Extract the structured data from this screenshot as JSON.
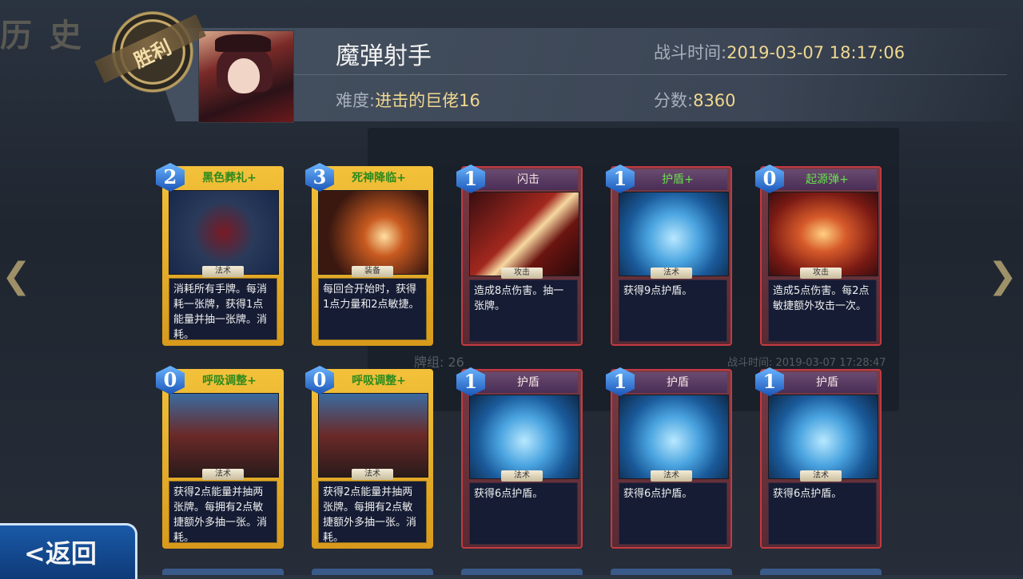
{
  "header": {
    "seal_text": "胜利",
    "character_name": "魔弹射手",
    "difficulty_label": "难度:",
    "difficulty_value": "进击的巨佬16",
    "time_label": "战斗时间:",
    "time_value": "2019-03-07 18:17:06",
    "score_label": "分数:",
    "score_value": "8360"
  },
  "background_text": {
    "history": "历 史",
    "deck_label": "牌组:",
    "deck_value": "26",
    "battle_time": "战斗时间: 2019-03-07 17:28:47"
  },
  "cards": [
    {
      "cost": "2",
      "title": "黑色葬礼+",
      "type": "法术",
      "desc": "消耗所有手牌。每消耗一张牌，获得1点能量并抽一张牌。消耗。",
      "style": "gold",
      "art": "black"
    },
    {
      "cost": "3",
      "title": "死神降临+",
      "type": "装备",
      "desc": "每回合开始时，获得1点力量和2点敏捷。",
      "style": "gold",
      "art": "dark"
    },
    {
      "cost": "1",
      "title": "闪击",
      "type": "攻击",
      "desc": "造成8点伤害。抽一张牌。",
      "style": "red",
      "art": "slash"
    },
    {
      "cost": "1",
      "title": "护盾+",
      "type": "法术",
      "desc": "获得9点护盾。",
      "style": "red",
      "art": "blue"
    },
    {
      "cost": "0",
      "title": "起源弹+",
      "type": "攻击",
      "desc": "造成5点伤害。每2点敏捷额外攻击一次。",
      "style": "red",
      "art": "origin"
    },
    {
      "cost": "0",
      "title": "呼吸调整+",
      "type": "法术",
      "desc": "获得2点能量并抽两张牌。每拥有2点敏捷额外多抽一张。消耗。",
      "style": "gold",
      "art": "breath"
    },
    {
      "cost": "0",
      "title": "呼吸调整+",
      "type": "法术",
      "desc": "获得2点能量并抽两张牌。每拥有2点敏捷额外多抽一张。消耗。",
      "style": "gold",
      "art": "breath"
    },
    {
      "cost": "1",
      "title": "护盾",
      "type": "法术",
      "desc": "获得6点护盾。",
      "style": "red",
      "art": "blue"
    },
    {
      "cost": "1",
      "title": "护盾",
      "type": "法术",
      "desc": "获得6点护盾。",
      "style": "red",
      "art": "blue"
    },
    {
      "cost": "1",
      "title": "护盾",
      "type": "法术",
      "desc": "获得6点护盾。",
      "style": "red",
      "art": "blue"
    }
  ],
  "nav": {
    "back_label": "<返回",
    "prev_arrow": "❮",
    "next_arrow": "❯"
  }
}
